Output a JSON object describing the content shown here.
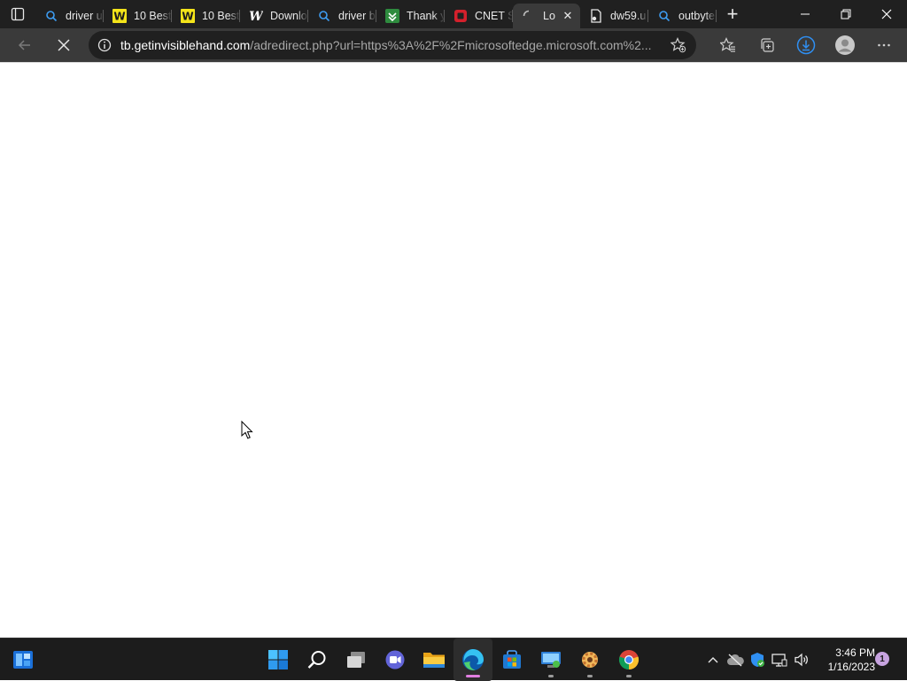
{
  "browser": {
    "tabs": [
      {
        "title": "driver u",
        "icon": "search-icon",
        "active": false
      },
      {
        "title": "10 Best",
        "icon": "w-logo-yellow-icon",
        "active": false
      },
      {
        "title": "10 Best",
        "icon": "w-logo-yellow-icon",
        "active": false
      },
      {
        "title": "Downlo",
        "icon": "w-logo-blue-icon",
        "active": false
      },
      {
        "title": "driver b",
        "icon": "search-icon",
        "active": false
      },
      {
        "title": "Thank y",
        "icon": "green-download-icon",
        "active": false
      },
      {
        "title": "CNET S",
        "icon": "cnet-icon",
        "active": false
      },
      {
        "title": "Lo",
        "icon": "loading-spinner-icon",
        "active": true
      },
      {
        "title": "dw59.u",
        "icon": "file-icon",
        "active": false
      },
      {
        "title": "outbyte",
        "icon": "search-icon",
        "active": false
      }
    ],
    "address": {
      "host": "tb.getinvisiblehand.com",
      "path": "/adredirect.php?url=https%3A%2F%2Fmicrosoftedge.microsoft.com%2..."
    }
  },
  "taskbar": {
    "apps": [
      "start-button",
      "search-button",
      "task-view-button",
      "teams-chat-button",
      "file-explorer-button",
      "edge-button",
      "store-button",
      "remote-app-button",
      "settings-app-button",
      "chrome-button"
    ],
    "clock": {
      "time": "3:46 PM",
      "date": "1/16/2023"
    },
    "notification_count": "1"
  },
  "colors": {
    "titlebar": "#202020",
    "toolbar": "#3a3a3a",
    "taskbar": "#1c1c1c",
    "accent": "#2f8ff2"
  }
}
